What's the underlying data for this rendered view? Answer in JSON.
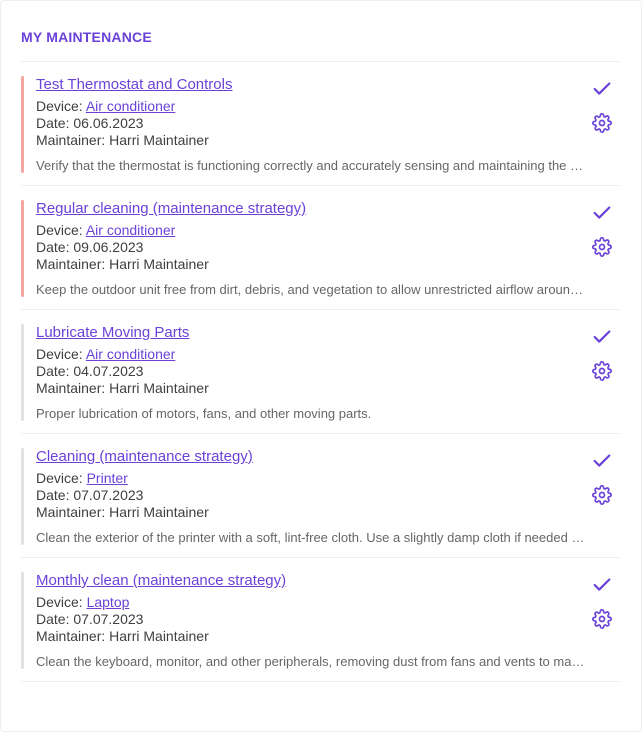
{
  "panel": {
    "title": "MY MAINTENANCE"
  },
  "labels": {
    "device_prefix": "Device: ",
    "date_prefix": "Date: ",
    "maintainer_prefix": "Maintainer: "
  },
  "items": [
    {
      "title": "Test Thermostat and Controls",
      "device": "Air conditioner",
      "date": "06.06.2023",
      "maintainer": "Harri Maintainer",
      "description": "Verify that the thermostat is functioning correctly and accurately sensing and maintaining the set temperature.",
      "status": "overdue"
    },
    {
      "title": "Regular cleaning (maintenance strategy)",
      "device": "Air conditioner",
      "date": "09.06.2023",
      "maintainer": "Harri Maintainer",
      "description": "Keep the outdoor unit free from dirt, debris, and vegetation to allow unrestricted airflow around the condenser.",
      "status": "overdue"
    },
    {
      "title": "Lubricate Moving Parts",
      "device": "Air conditioner",
      "date": "04.07.2023",
      "maintainer": "Harri Maintainer",
      "description": "Proper lubrication of motors, fans, and other moving parts.",
      "status": "normal"
    },
    {
      "title": "Cleaning (maintenance strategy)",
      "device": "Printer",
      "date": "07.07.2023",
      "maintainer": "Harri Maintainer",
      "description": "Clean the exterior of the printer with a soft, lint-free cloth. Use a slightly damp cloth if needed to remove dust and smudges.",
      "status": "normal"
    },
    {
      "title": "Monthly clean (maintenance strategy)",
      "device": "Laptop",
      "date": "07.07.2023",
      "maintainer": "Harri Maintainer",
      "description": "Clean the keyboard, monitor, and other peripherals, removing dust from fans and vents to maintain performance.",
      "status": "normal"
    }
  ]
}
